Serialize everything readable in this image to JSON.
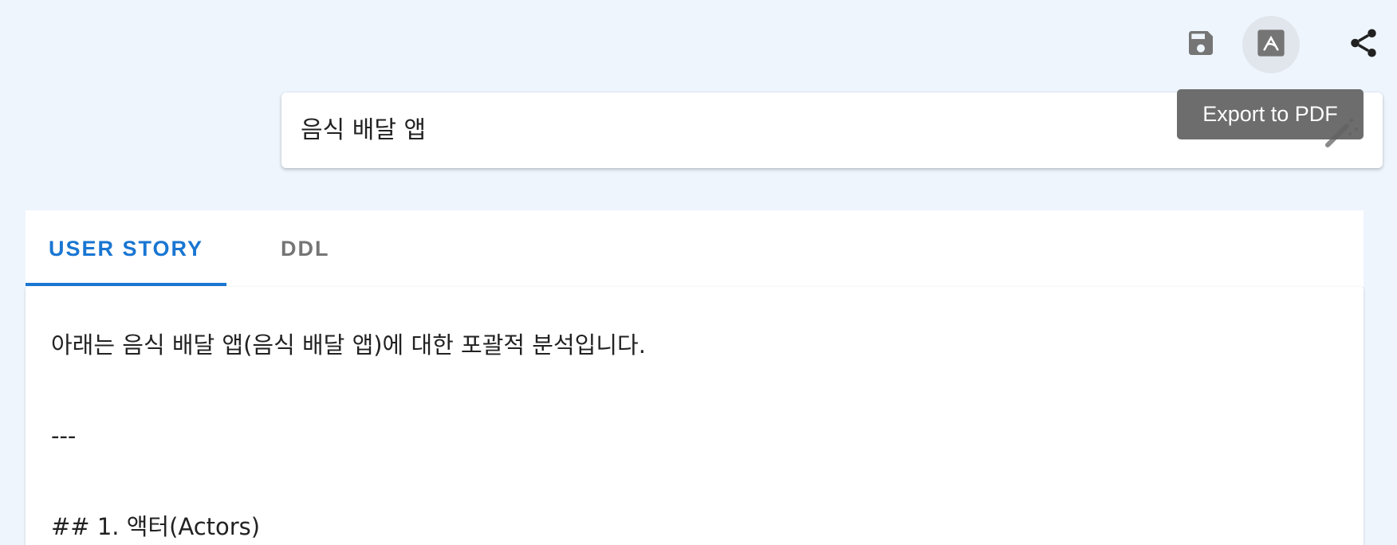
{
  "toolbar": {
    "save_icon": "save-icon",
    "pdf_icon": "pdf-icon",
    "share_icon": "share-icon",
    "tooltip": "Export to PDF"
  },
  "title_field": {
    "value": "음식 배달 앱",
    "action_icon": "magic-wand-icon"
  },
  "tabs": [
    {
      "label": "USER STORY",
      "active": true
    },
    {
      "label": "DDL",
      "active": false
    }
  ],
  "content": {
    "lines": [
      "아래는 음식 배달 앱(음식 배달 앱)에 대한 포괄적 분석입니다.",
      "---",
      "## 1. 액터(Actors)"
    ]
  },
  "colors": {
    "background": "#eef5fd",
    "accent": "#1976d2",
    "tooltip_bg": "#616161",
    "inactive_tab": "#757575"
  }
}
